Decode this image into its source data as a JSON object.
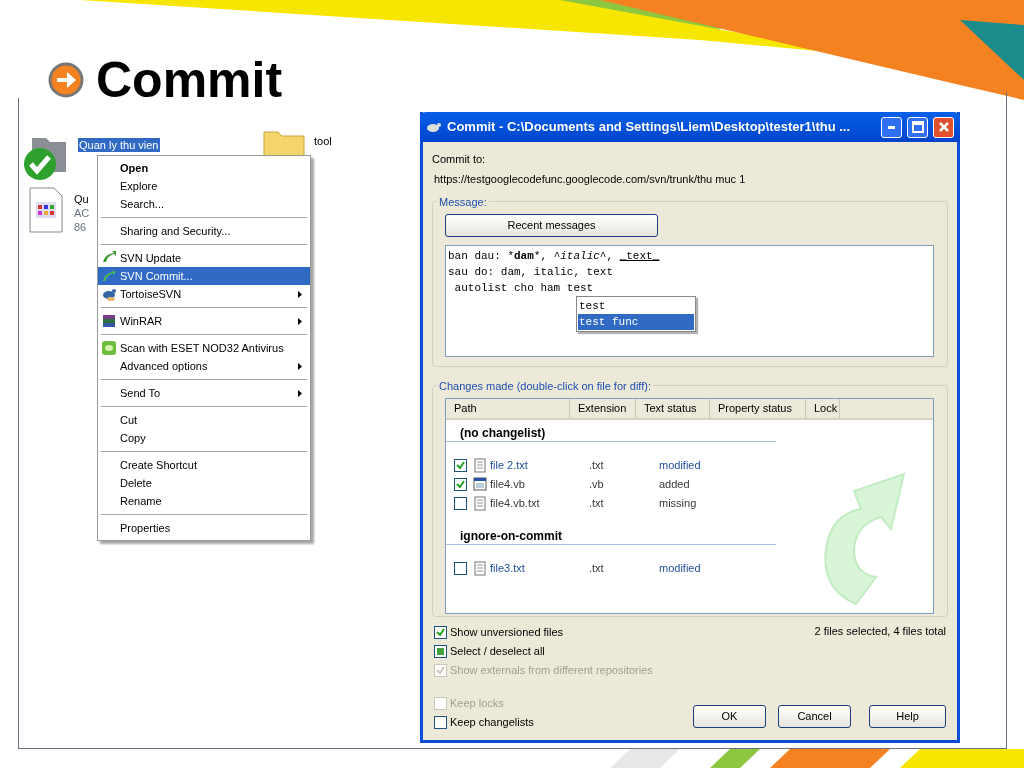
{
  "slide": {
    "title": "Commit"
  },
  "explorer": {
    "items": [
      {
        "kind": "folder-ok",
        "lines": [
          "Quan ly thu vien"
        ],
        "selected": true
      },
      {
        "kind": "folder",
        "lines": [
          "tool"
        ],
        "selected": false
      },
      {
        "kind": "file",
        "lines": [
          "Qu",
          "AC",
          "86"
        ],
        "selected": false
      }
    ],
    "menu": [
      [
        {
          "label": "Open",
          "kind": "plain",
          "default": true,
          "submenu": false,
          "selected": false
        },
        {
          "label": "Explore",
          "kind": "plain",
          "default": false,
          "submenu": false,
          "selected": false
        },
        {
          "label": "Search...",
          "kind": "plain",
          "default": false,
          "submenu": false,
          "selected": false
        }
      ],
      [
        {
          "label": "Sharing and Security...",
          "kind": "plain",
          "default": false,
          "submenu": false,
          "selected": false
        }
      ],
      [
        {
          "label": "SVN Update",
          "kind": "svn-update",
          "default": false,
          "submenu": false,
          "selected": false
        },
        {
          "label": "SVN Commit...",
          "kind": "svn-commit",
          "default": false,
          "submenu": false,
          "selected": true
        },
        {
          "label": "TortoiseSVN",
          "kind": "tortoise",
          "default": false,
          "submenu": true,
          "selected": false
        }
      ],
      [
        {
          "label": "WinRAR",
          "kind": "winrar",
          "default": false,
          "submenu": true,
          "selected": false
        }
      ],
      [
        {
          "label": "Scan with ESET NOD32 Antivirus",
          "kind": "antivirus",
          "default": false,
          "submenu": false,
          "selected": false
        },
        {
          "label": "Advanced options",
          "kind": "plain",
          "default": false,
          "submenu": true,
          "selected": false
        }
      ],
      [
        {
          "label": "Send To",
          "kind": "plain",
          "default": false,
          "submenu": true,
          "selected": false
        }
      ],
      [
        {
          "label": "Cut",
          "kind": "plain",
          "default": false,
          "submenu": false,
          "selected": false
        },
        {
          "label": "Copy",
          "kind": "plain",
          "default": false,
          "submenu": false,
          "selected": false
        }
      ],
      [
        {
          "label": "Create Shortcut",
          "kind": "plain",
          "default": false,
          "submenu": false,
          "selected": false
        },
        {
          "label": "Delete",
          "kind": "plain",
          "default": false,
          "submenu": false,
          "selected": false
        },
        {
          "label": "Rename",
          "kind": "plain",
          "default": false,
          "submenu": false,
          "selected": false
        }
      ],
      [
        {
          "label": "Properties",
          "kind": "plain",
          "default": false,
          "submenu": false,
          "selected": false
        }
      ]
    ]
  },
  "dialog": {
    "title": "Commit - C:\\Documents and Settings\\Liem\\Desktop\\tester1\\thu ...",
    "commit_to_label": "Commit to:",
    "url": "https://testgooglecodefunc.googlecode.com/svn/trunk/thu muc 1",
    "message_group": "Message:",
    "recent_button": "Recent messages",
    "message_lines": [
      [
        {
          "text": "ban dau: *",
          "kind": "plain"
        },
        {
          "text": "dam",
          "kind": "bold"
        },
        {
          "text": "*, ^",
          "kind": "plain"
        },
        {
          "text": "italic",
          "kind": "italic"
        },
        {
          "text": "^, ",
          "kind": "plain"
        },
        {
          "text": "_text_",
          "kind": "underline"
        }
      ],
      [
        {
          "text": "sau do: dam, italic, text",
          "kind": "plain"
        }
      ],
      [
        {
          "text": " autolist cho ham test",
          "kind": "plain"
        }
      ]
    ],
    "autocomplete": [
      {
        "label": "test",
        "selected": false
      },
      {
        "label": "test func",
        "selected": true
      }
    ],
    "changes_group": "Changes made (double-click on file for diff):",
    "columns": [
      "Path",
      "Extension",
      "Text status",
      "Property status",
      "Lock"
    ],
    "groups": [
      {
        "name": "(no changelist)",
        "rows": [
          {
            "checked": true,
            "kind": "text",
            "path": "file 2.txt",
            "extension": ".txt",
            "status": "modified",
            "color": "#1f4e9c"
          },
          {
            "checked": true,
            "kind": "vb",
            "path": "file4.vb",
            "extension": ".vb",
            "status": "added",
            "color": "#3a3a3a"
          },
          {
            "checked": false,
            "kind": "text",
            "path": "file4.vb.txt",
            "extension": ".txt",
            "status": "missing",
            "color": "#3a3a3a"
          }
        ]
      },
      {
        "name": "ignore-on-commit",
        "rows": [
          {
            "checked": false,
            "kind": "text",
            "path": "file3.txt",
            "extension": ".txt",
            "status": "modified",
            "color": "#1f4e9c"
          }
        ]
      }
    ],
    "summary": "2 files selected, 4 files total",
    "options": [
      {
        "kind": "checkbox",
        "label": "Show unversioned files",
        "checked": true,
        "disabled": false
      },
      {
        "kind": "tristate",
        "label": "Select / deselect all",
        "indeterminate": true,
        "disabled": false
      },
      {
        "kind": "checkbox",
        "label": "Show externals from different repositories",
        "checked": true,
        "disabled": true
      }
    ],
    "bottom_options": [
      {
        "label": "Keep locks",
        "checked": false,
        "disabled": true
      },
      {
        "label": "Keep changelists",
        "checked": false,
        "disabled": false
      }
    ],
    "buttons": [
      "OK",
      "Cancel",
      "Help"
    ]
  }
}
